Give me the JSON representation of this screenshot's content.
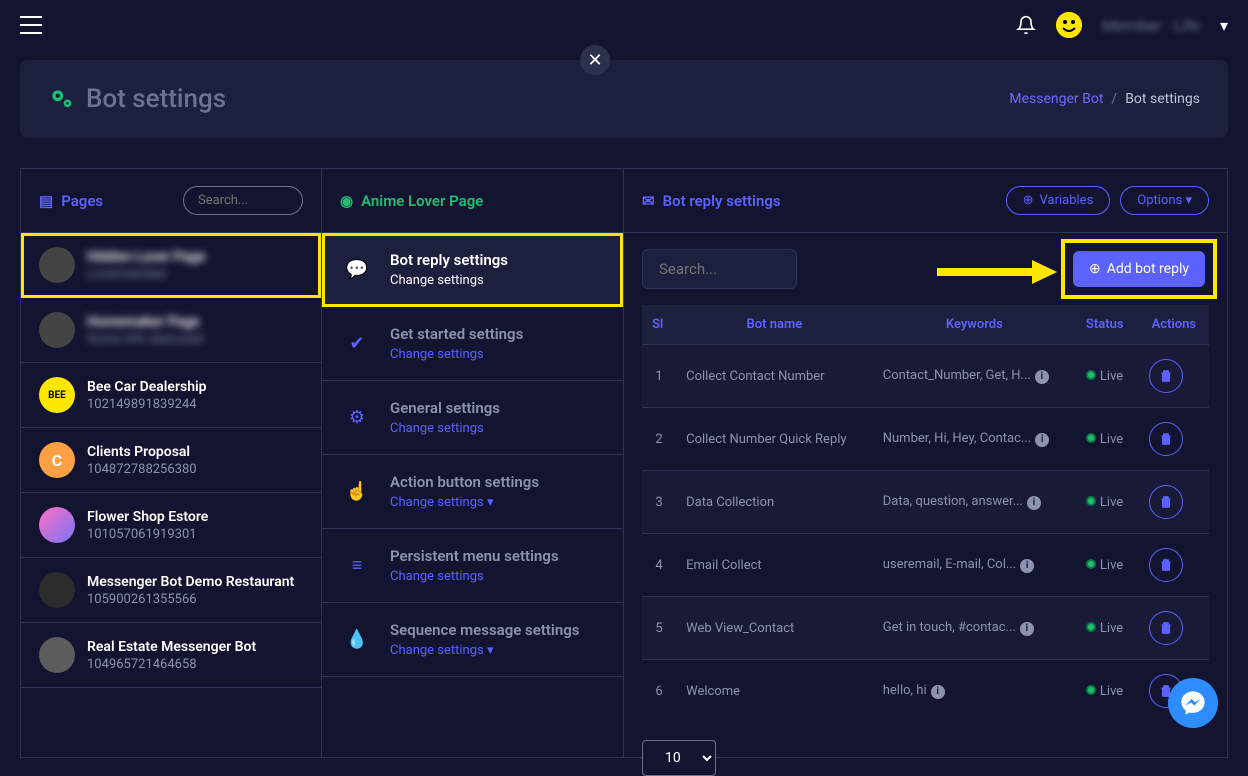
{
  "topbar": {
    "user": "Member · Life"
  },
  "header": {
    "title": "Bot settings",
    "breadcrumb": {
      "link": "Messenger Bot",
      "current": "Bot settings"
    }
  },
  "col1": {
    "title": "Pages",
    "search_placeholder": "Search...",
    "pages": [
      {
        "name": "Hidden Lover Page",
        "sub": "Lovermember",
        "blurred": true,
        "avatarClass": ""
      },
      {
        "name": "Homemaker Page",
        "sub": "Some info obscured",
        "blurred": true,
        "avatarClass": ""
      },
      {
        "name": "Bee Car Dealership",
        "sub": "102149891839244",
        "avatarClass": "yellow",
        "avatarText": "BEE"
      },
      {
        "name": "Clients Proposal",
        "sub": "104872788256380",
        "avatarClass": "orange",
        "avatarText": "C"
      },
      {
        "name": "Flower Shop Estore",
        "sub": "101057061919301",
        "avatarClass": "pink",
        "avatarText": ""
      },
      {
        "name": "Messenger Bot Demo Restaurant",
        "sub": "105900261355566",
        "avatarClass": "dark",
        "avatarText": ""
      },
      {
        "name": "Real Estate Messenger Bot",
        "sub": "104965721464658",
        "avatarClass": "grey",
        "avatarText": ""
      }
    ]
  },
  "col2": {
    "title": "Anime Lover Page",
    "items": [
      {
        "title": "Bot reply settings",
        "link": "Change settings",
        "icon": "chat",
        "highlight": true
      },
      {
        "title": "Get started settings",
        "link": "Change settings",
        "icon": "check"
      },
      {
        "title": "General settings",
        "link": "Change settings",
        "icon": "gear"
      },
      {
        "title": "Action button settings",
        "link": "Change settings ▾",
        "icon": "pointer"
      },
      {
        "title": "Persistent menu settings",
        "link": "Change settings",
        "icon": "menu"
      },
      {
        "title": "Sequence message settings",
        "link": "Change settings ▾",
        "icon": "drop"
      }
    ]
  },
  "col3": {
    "title": "Bot reply settings",
    "variables_btn": "Variables",
    "options_btn": "Options ▾",
    "search_placeholder": "Search...",
    "add_btn": "Add bot reply",
    "headers": {
      "sl": "Sl",
      "bot": "Bot name",
      "kw": "Keywords",
      "status": "Status",
      "actions": "Actions"
    },
    "rows": [
      {
        "sl": "1",
        "bot": "Collect Contact Number",
        "kw": "Contact_Number, Get, H...",
        "status": "Live"
      },
      {
        "sl": "2",
        "bot": "Collect Number Quick Reply",
        "kw": "Number, Hi, Hey, Contac...",
        "status": "Live"
      },
      {
        "sl": "3",
        "bot": "Data Collection",
        "kw": "Data, question, answer...",
        "status": "Live"
      },
      {
        "sl": "4",
        "bot": "Email Collect",
        "kw": "useremail, E-mail, Col...",
        "status": "Live"
      },
      {
        "sl": "5",
        "bot": "Web View_Contact",
        "kw": "Get in touch, #contac...",
        "status": "Live"
      },
      {
        "sl": "6",
        "bot": "Welcome",
        "kw": "hello, hi",
        "status": "Live"
      }
    ],
    "page_size": "10"
  }
}
